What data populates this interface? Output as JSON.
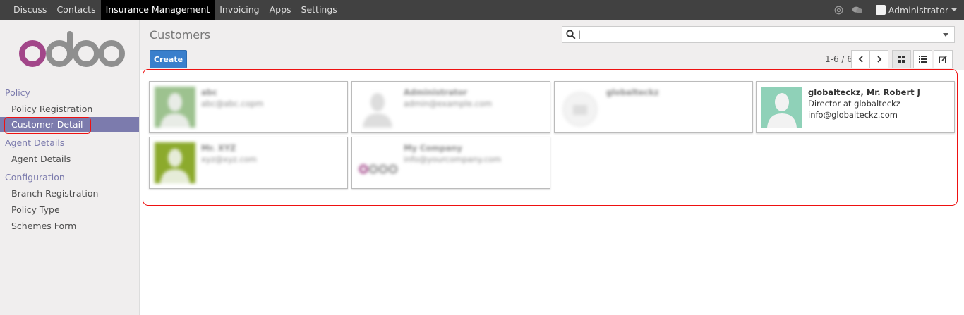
{
  "topbar": {
    "menu": [
      "Discuss",
      "Contacts",
      "Insurance Management",
      "Invoicing",
      "Apps",
      "Settings"
    ],
    "active_index": 2,
    "user": "Administrator"
  },
  "sidebar": {
    "logo_text": "odoo",
    "sections": [
      {
        "title": "Policy",
        "items": [
          "Policy Registration",
          "Customer Detail"
        ]
      },
      {
        "title": "Agent Details",
        "items": [
          "Agent Details"
        ]
      },
      {
        "title": "Configuration",
        "items": [
          "Branch Registration",
          "Policy Type",
          "Schemes Form"
        ]
      }
    ],
    "active_item": "Customer Detail"
  },
  "control_panel": {
    "title": "Customers",
    "search_value": "|",
    "create_label": "Create",
    "pager": "1-6 / 6"
  },
  "cards": [
    {
      "name": "abc",
      "line2": "abc@abc.copm",
      "line3": "",
      "blurred": true
    },
    {
      "name": "Administrator",
      "line2": "admin@example.com",
      "line3": "",
      "blurred": true
    },
    {
      "name": "globalteckz",
      "line2": "",
      "line3": "",
      "blurred": true
    },
    {
      "name": "globalteckz, Mr. Robert J",
      "line2": "Director at globalteckz",
      "line3": "info@globalteckz.com",
      "blurred": false
    },
    {
      "name": "Mr. XYZ",
      "line2": "xyz@xyz.com",
      "line3": "",
      "blurred": true
    },
    {
      "name": "My Company",
      "line2": "info@yourcompany.com",
      "line3": "",
      "blurred": true
    }
  ],
  "colors": {
    "topbar": "#414141",
    "accent": "#7c7bad",
    "primary_button": "#3a7fcc",
    "highlight": "#ee1111"
  }
}
